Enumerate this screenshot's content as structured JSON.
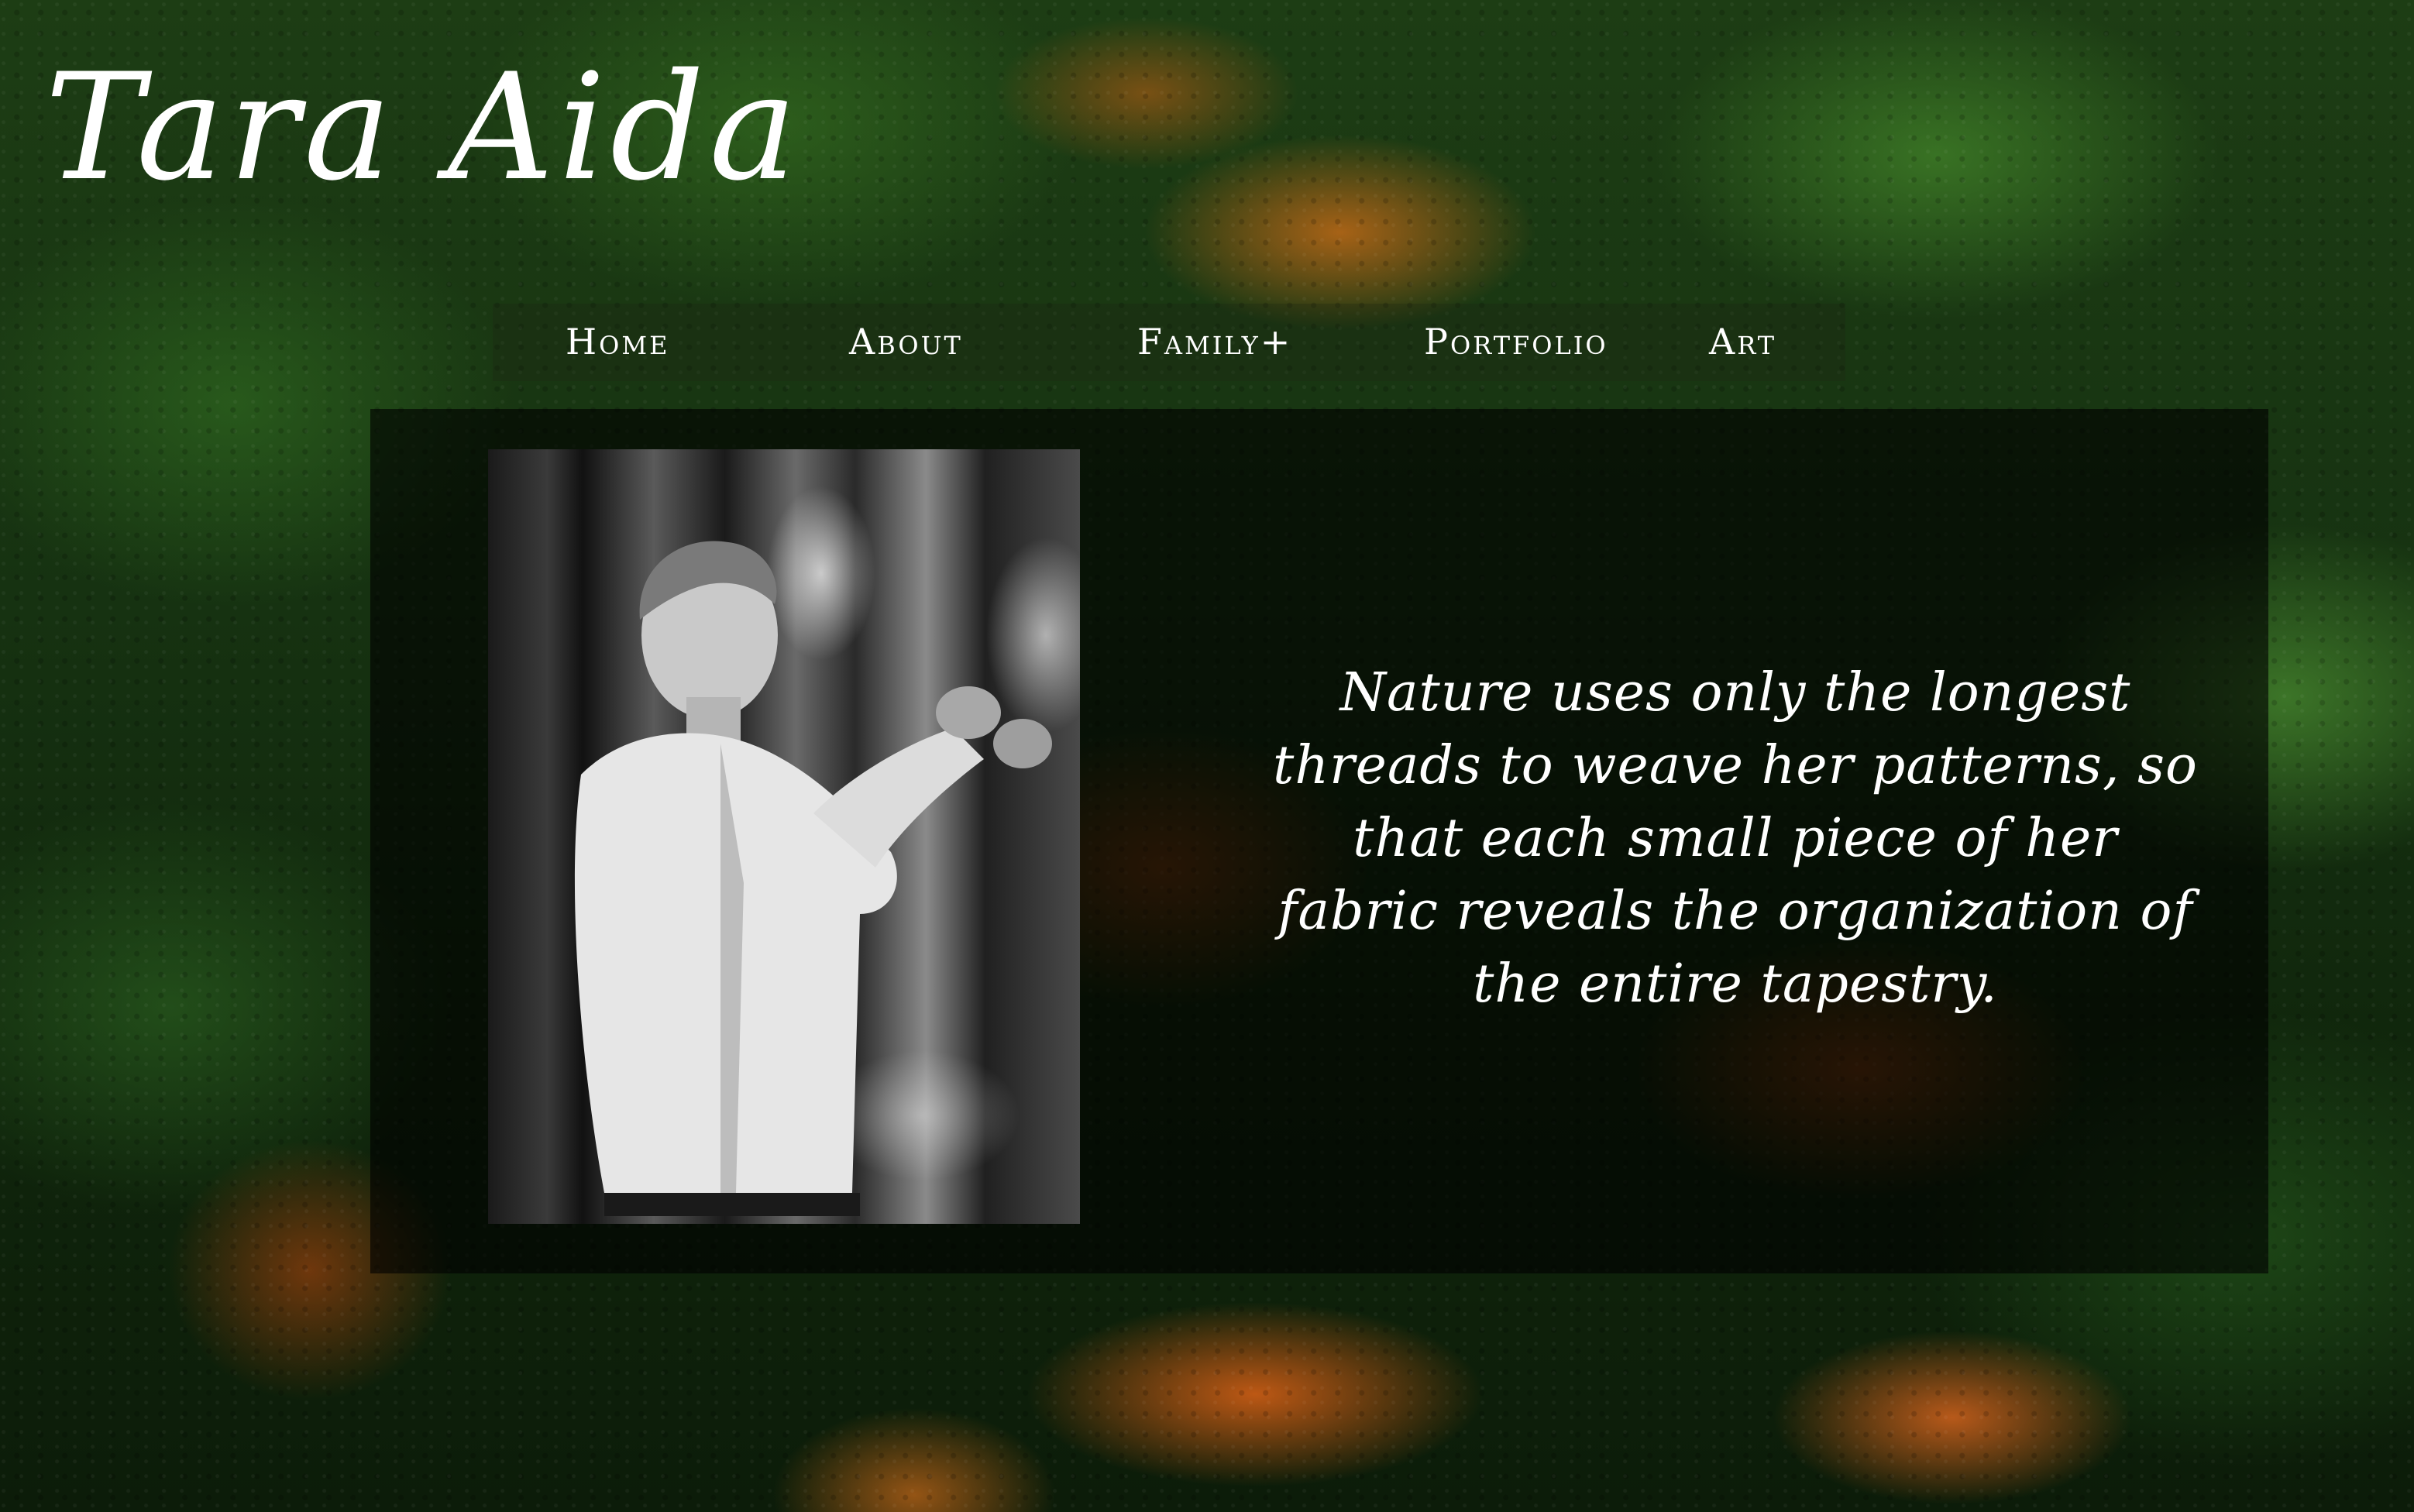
{
  "site": {
    "title": "Tara Aida"
  },
  "nav": {
    "items": [
      {
        "label": "Home"
      },
      {
        "label": "About"
      },
      {
        "label": "Family+"
      },
      {
        "label": "Portfolio"
      },
      {
        "label": "Art"
      }
    ]
  },
  "main": {
    "quote": "Nature uses only the longest threads to weave her patterns, so that each small piece of her fabric reveals the organization of the entire tapestry.",
    "portrait": {
      "icon": "portrait-photo",
      "style": "black-and-white"
    }
  },
  "colors": {
    "text": "#ffffff",
    "background": "#163211",
    "accent_foliage": "#d67018",
    "panel_overlay": "#000000"
  }
}
